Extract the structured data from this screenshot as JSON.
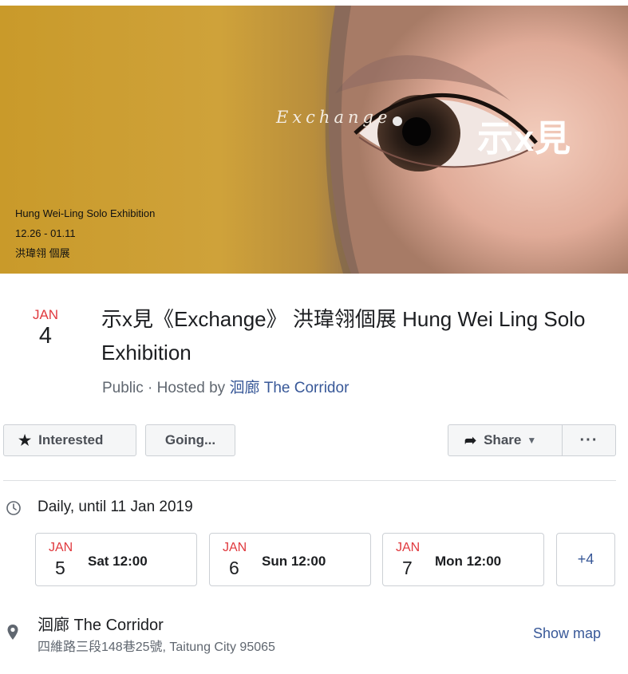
{
  "cover": {
    "exchange_text": "Exchange",
    "big_title": "示x見",
    "info_lines": [
      "Hung Wei-Ling  Solo Exhibition",
      "12.26 - 01.11",
      "洪瑋翎 個展"
    ]
  },
  "event": {
    "month": "JAN",
    "day": "4",
    "title": "示x見《Exchange》 洪瑋翎個展 Hung Wei Ling Solo Exhibition",
    "visibility": "Public",
    "hosted_by_prefix": " · Hosted by ",
    "host": "洄廊 The Corridor"
  },
  "actions": {
    "interested": "Interested",
    "going": "Going...",
    "share": "Share",
    "more": "···"
  },
  "schedule": {
    "label": "Daily, until 11 Jan 2019",
    "dates": [
      {
        "month": "JAN",
        "day": "5",
        "time": "Sat 12:00"
      },
      {
        "month": "JAN",
        "day": "6",
        "time": "Sun 12:00"
      },
      {
        "month": "JAN",
        "day": "7",
        "time": "Mon 12:00"
      }
    ],
    "more": "+4"
  },
  "location": {
    "name": "洄廊 The Corridor",
    "address": "四維路三段148巷25號, Taitung City 95065",
    "show_map": "Show map"
  },
  "colors": {
    "accent_red": "#e0393e",
    "link_blue": "#385898"
  }
}
